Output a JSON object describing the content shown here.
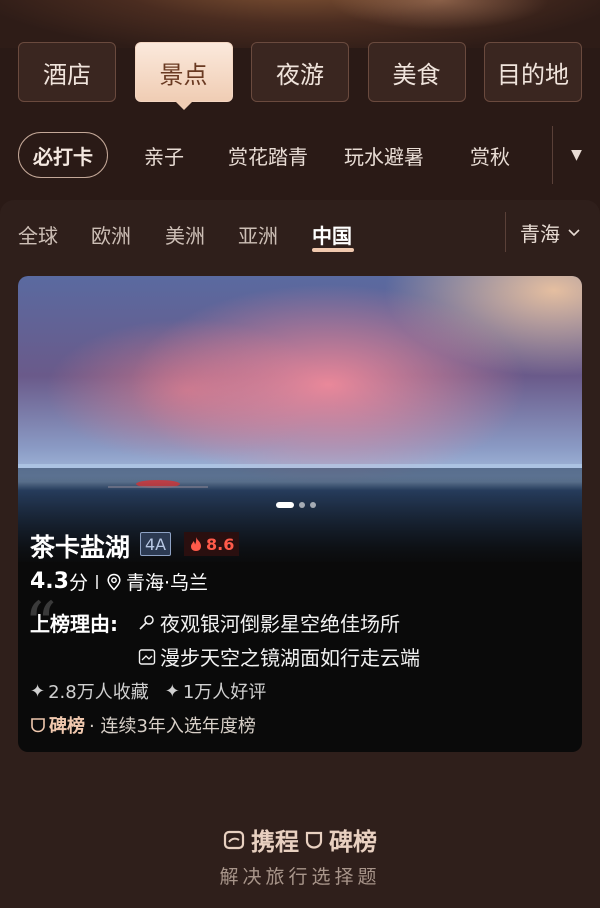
{
  "category_tabs": [
    "酒店",
    "景点",
    "夜游",
    "美食",
    "目的地"
  ],
  "active_category": "景点",
  "themes": {
    "pill": "必打卡",
    "items": [
      "亲子",
      "赏花踏青",
      "玩水避暑",
      "赏秋"
    ]
  },
  "regions": {
    "items": [
      "全球",
      "欧洲",
      "美洲",
      "亚洲",
      "中国"
    ],
    "active": "中国",
    "selected_province": "青海"
  },
  "card": {
    "name": "茶卡盐湖",
    "level": "4A",
    "heat": "8.6",
    "score": "4.3",
    "score_unit": "分",
    "location": "青海·乌兰",
    "reason_label": "上榜理由:",
    "reasons": [
      "夜观银河倒影星空绝佳场所",
      "漫步天空之镜湖面如行走云端"
    ],
    "favorites": "2.8万人收藏",
    "reviews": "1万人好评",
    "board_name": "碑榜",
    "board_note": "· 连续3年入选年度榜",
    "slides": 3,
    "active_slide": 1
  },
  "footer": {
    "brand_left": "携程",
    "brand_right": "碑榜",
    "slogan": "解决旅行选择题"
  },
  "colors": {
    "background": "#2a1a16",
    "active_tab": "#f0cdb4",
    "heat": "#ff5a4a",
    "accent": "#f0c8ae"
  }
}
